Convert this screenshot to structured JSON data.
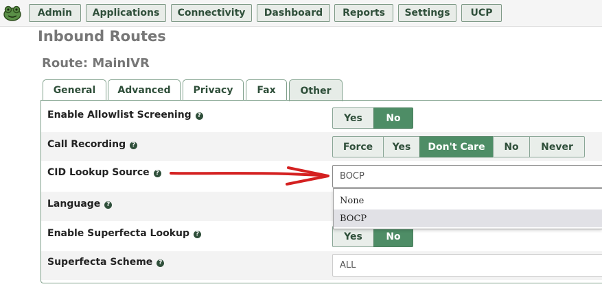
{
  "nav": {
    "logo_icon": "frog-logo-icon",
    "items": [
      "Admin",
      "Applications",
      "Connectivity",
      "Dashboard",
      "Reports",
      "Settings",
      "UCP"
    ]
  },
  "page": {
    "title": "Inbound Routes",
    "route_title": "Route: MainIVR"
  },
  "tabs": [
    {
      "label": "General",
      "active": false
    },
    {
      "label": "Advanced",
      "active": false
    },
    {
      "label": "Privacy",
      "active": false
    },
    {
      "label": "Fax",
      "active": false
    },
    {
      "label": "Other",
      "active": true
    }
  ],
  "fields": {
    "allowlist": {
      "label": "Enable Allowlist Screening",
      "options": [
        "Yes",
        "No"
      ],
      "selected": "No"
    },
    "call_recording": {
      "label": "Call Recording",
      "options": [
        "Force",
        "Yes",
        "Don't Care",
        "No",
        "Never"
      ],
      "selected": "Don't Care"
    },
    "cid_lookup": {
      "label": "CID Lookup Source",
      "value": "BOCP",
      "dropdown_options": [
        "None",
        "BOCP"
      ],
      "highlighted": "BOCP"
    },
    "language": {
      "label": "Language"
    },
    "superfecta_lookup": {
      "label": "Enable Superfecta Lookup",
      "options": [
        "Yes",
        "No"
      ],
      "selected": "No"
    },
    "superfecta_scheme": {
      "label": "Superfecta Scheme",
      "value": "ALL"
    }
  },
  "help_icon": "?",
  "colors": {
    "accent_green": "#4e8d66",
    "annotation_arrow": "#d42020"
  }
}
